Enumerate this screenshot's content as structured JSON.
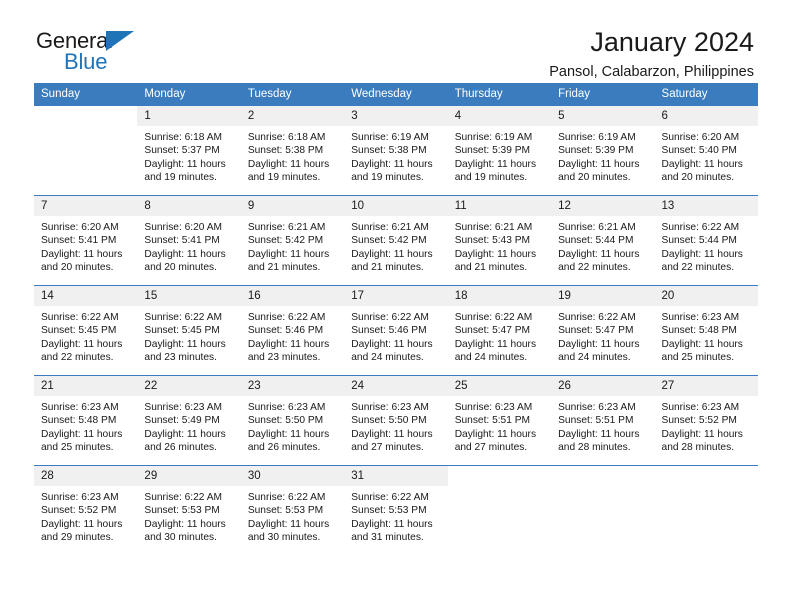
{
  "brand": {
    "name_part1": "General",
    "name_part2": "Blue",
    "triangle_icon": "triangle-icon",
    "accent_color": "#1f73b7"
  },
  "header": {
    "title": "January 2024",
    "subtitle": "Pansol, Calabarzon, Philippines"
  },
  "calendar": {
    "header_color": "#3a7cbd",
    "daynum_bg": "#f0f0f0",
    "weekdays": [
      "Sunday",
      "Monday",
      "Tuesday",
      "Wednesday",
      "Thursday",
      "Friday",
      "Saturday"
    ],
    "labels": {
      "sunrise": "Sunrise:",
      "sunset": "Sunset:",
      "daylight": "Daylight:"
    },
    "weeks": [
      [
        {
          "day": "",
          "sunrise": "",
          "sunset": "",
          "daylight1": "",
          "daylight2": ""
        },
        {
          "day": "1",
          "sunrise": "Sunrise: 6:18 AM",
          "sunset": "Sunset: 5:37 PM",
          "daylight1": "Daylight: 11 hours",
          "daylight2": "and 19 minutes."
        },
        {
          "day": "2",
          "sunrise": "Sunrise: 6:18 AM",
          "sunset": "Sunset: 5:38 PM",
          "daylight1": "Daylight: 11 hours",
          "daylight2": "and 19 minutes."
        },
        {
          "day": "3",
          "sunrise": "Sunrise: 6:19 AM",
          "sunset": "Sunset: 5:38 PM",
          "daylight1": "Daylight: 11 hours",
          "daylight2": "and 19 minutes."
        },
        {
          "day": "4",
          "sunrise": "Sunrise: 6:19 AM",
          "sunset": "Sunset: 5:39 PM",
          "daylight1": "Daylight: 11 hours",
          "daylight2": "and 19 minutes."
        },
        {
          "day": "5",
          "sunrise": "Sunrise: 6:19 AM",
          "sunset": "Sunset: 5:39 PM",
          "daylight1": "Daylight: 11 hours",
          "daylight2": "and 20 minutes."
        },
        {
          "day": "6",
          "sunrise": "Sunrise: 6:20 AM",
          "sunset": "Sunset: 5:40 PM",
          "daylight1": "Daylight: 11 hours",
          "daylight2": "and 20 minutes."
        }
      ],
      [
        {
          "day": "7",
          "sunrise": "Sunrise: 6:20 AM",
          "sunset": "Sunset: 5:41 PM",
          "daylight1": "Daylight: 11 hours",
          "daylight2": "and 20 minutes."
        },
        {
          "day": "8",
          "sunrise": "Sunrise: 6:20 AM",
          "sunset": "Sunset: 5:41 PM",
          "daylight1": "Daylight: 11 hours",
          "daylight2": "and 20 minutes."
        },
        {
          "day": "9",
          "sunrise": "Sunrise: 6:21 AM",
          "sunset": "Sunset: 5:42 PM",
          "daylight1": "Daylight: 11 hours",
          "daylight2": "and 21 minutes."
        },
        {
          "day": "10",
          "sunrise": "Sunrise: 6:21 AM",
          "sunset": "Sunset: 5:42 PM",
          "daylight1": "Daylight: 11 hours",
          "daylight2": "and 21 minutes."
        },
        {
          "day": "11",
          "sunrise": "Sunrise: 6:21 AM",
          "sunset": "Sunset: 5:43 PM",
          "daylight1": "Daylight: 11 hours",
          "daylight2": "and 21 minutes."
        },
        {
          "day": "12",
          "sunrise": "Sunrise: 6:21 AM",
          "sunset": "Sunset: 5:44 PM",
          "daylight1": "Daylight: 11 hours",
          "daylight2": "and 22 minutes."
        },
        {
          "day": "13",
          "sunrise": "Sunrise: 6:22 AM",
          "sunset": "Sunset: 5:44 PM",
          "daylight1": "Daylight: 11 hours",
          "daylight2": "and 22 minutes."
        }
      ],
      [
        {
          "day": "14",
          "sunrise": "Sunrise: 6:22 AM",
          "sunset": "Sunset: 5:45 PM",
          "daylight1": "Daylight: 11 hours",
          "daylight2": "and 22 minutes."
        },
        {
          "day": "15",
          "sunrise": "Sunrise: 6:22 AM",
          "sunset": "Sunset: 5:45 PM",
          "daylight1": "Daylight: 11 hours",
          "daylight2": "and 23 minutes."
        },
        {
          "day": "16",
          "sunrise": "Sunrise: 6:22 AM",
          "sunset": "Sunset: 5:46 PM",
          "daylight1": "Daylight: 11 hours",
          "daylight2": "and 23 minutes."
        },
        {
          "day": "17",
          "sunrise": "Sunrise: 6:22 AM",
          "sunset": "Sunset: 5:46 PM",
          "daylight1": "Daylight: 11 hours",
          "daylight2": "and 24 minutes."
        },
        {
          "day": "18",
          "sunrise": "Sunrise: 6:22 AM",
          "sunset": "Sunset: 5:47 PM",
          "daylight1": "Daylight: 11 hours",
          "daylight2": "and 24 minutes."
        },
        {
          "day": "19",
          "sunrise": "Sunrise: 6:22 AM",
          "sunset": "Sunset: 5:47 PM",
          "daylight1": "Daylight: 11 hours",
          "daylight2": "and 24 minutes."
        },
        {
          "day": "20",
          "sunrise": "Sunrise: 6:23 AM",
          "sunset": "Sunset: 5:48 PM",
          "daylight1": "Daylight: 11 hours",
          "daylight2": "and 25 minutes."
        }
      ],
      [
        {
          "day": "21",
          "sunrise": "Sunrise: 6:23 AM",
          "sunset": "Sunset: 5:48 PM",
          "daylight1": "Daylight: 11 hours",
          "daylight2": "and 25 minutes."
        },
        {
          "day": "22",
          "sunrise": "Sunrise: 6:23 AM",
          "sunset": "Sunset: 5:49 PM",
          "daylight1": "Daylight: 11 hours",
          "daylight2": "and 26 minutes."
        },
        {
          "day": "23",
          "sunrise": "Sunrise: 6:23 AM",
          "sunset": "Sunset: 5:50 PM",
          "daylight1": "Daylight: 11 hours",
          "daylight2": "and 26 minutes."
        },
        {
          "day": "24",
          "sunrise": "Sunrise: 6:23 AM",
          "sunset": "Sunset: 5:50 PM",
          "daylight1": "Daylight: 11 hours",
          "daylight2": "and 27 minutes."
        },
        {
          "day": "25",
          "sunrise": "Sunrise: 6:23 AM",
          "sunset": "Sunset: 5:51 PM",
          "daylight1": "Daylight: 11 hours",
          "daylight2": "and 27 minutes."
        },
        {
          "day": "26",
          "sunrise": "Sunrise: 6:23 AM",
          "sunset": "Sunset: 5:51 PM",
          "daylight1": "Daylight: 11 hours",
          "daylight2": "and 28 minutes."
        },
        {
          "day": "27",
          "sunrise": "Sunrise: 6:23 AM",
          "sunset": "Sunset: 5:52 PM",
          "daylight1": "Daylight: 11 hours",
          "daylight2": "and 28 minutes."
        }
      ],
      [
        {
          "day": "28",
          "sunrise": "Sunrise: 6:23 AM",
          "sunset": "Sunset: 5:52 PM",
          "daylight1": "Daylight: 11 hours",
          "daylight2": "and 29 minutes."
        },
        {
          "day": "29",
          "sunrise": "Sunrise: 6:22 AM",
          "sunset": "Sunset: 5:53 PM",
          "daylight1": "Daylight: 11 hours",
          "daylight2": "and 30 minutes."
        },
        {
          "day": "30",
          "sunrise": "Sunrise: 6:22 AM",
          "sunset": "Sunset: 5:53 PM",
          "daylight1": "Daylight: 11 hours",
          "daylight2": "and 30 minutes."
        },
        {
          "day": "31",
          "sunrise": "Sunrise: 6:22 AM",
          "sunset": "Sunset: 5:53 PM",
          "daylight1": "Daylight: 11 hours",
          "daylight2": "and 31 minutes."
        },
        {
          "day": "",
          "sunrise": "",
          "sunset": "",
          "daylight1": "",
          "daylight2": ""
        },
        {
          "day": "",
          "sunrise": "",
          "sunset": "",
          "daylight1": "",
          "daylight2": ""
        },
        {
          "day": "",
          "sunrise": "",
          "sunset": "",
          "daylight1": "",
          "daylight2": ""
        }
      ]
    ]
  }
}
